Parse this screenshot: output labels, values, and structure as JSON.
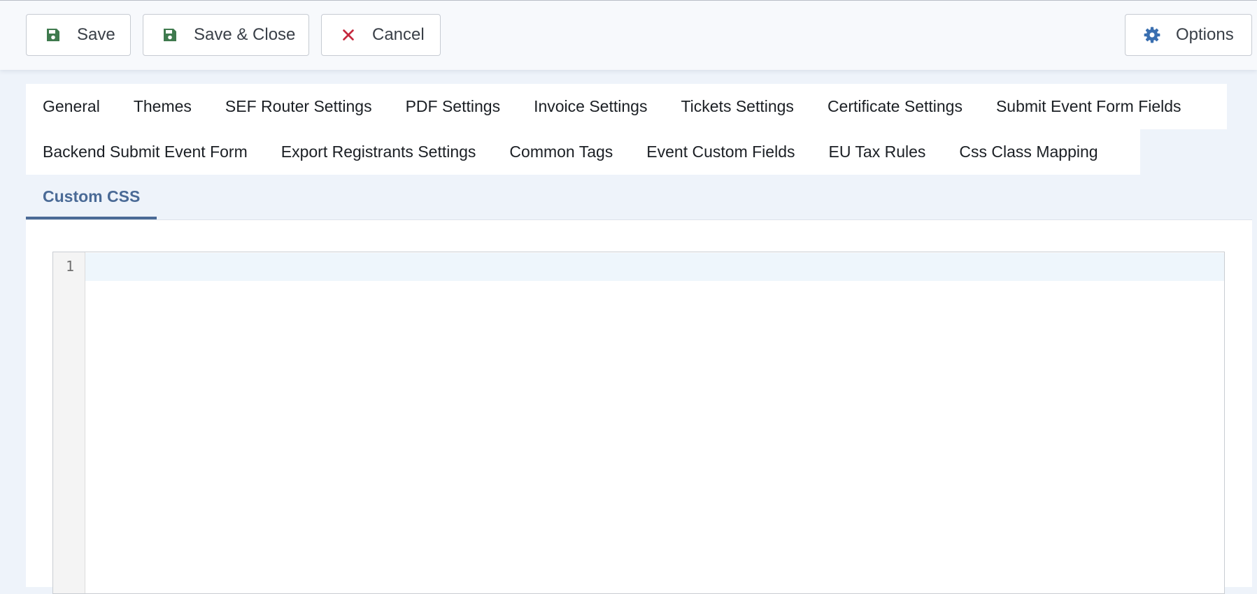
{
  "toolbar": {
    "save_label": "Save",
    "save_close_label": "Save & Close",
    "cancel_label": "Cancel",
    "options_label": "Options"
  },
  "tabs": {
    "row1": [
      "General",
      "Themes",
      "SEF Router Settings",
      "PDF Settings",
      "Invoice Settings",
      "Tickets Settings",
      "Certificate Settings",
      "Submit Event Form Fields"
    ],
    "row2": [
      "Backend Submit Event Form",
      "Export Registrants Settings",
      "Common Tags",
      "Event Custom Fields",
      "EU Tax Rules",
      "Css Class Mapping"
    ],
    "active": "Custom CSS"
  },
  "editor": {
    "line_numbers": [
      "1"
    ]
  },
  "colors": {
    "save_icon": "#3f7a4e",
    "cancel_icon": "#c5283d",
    "options_icon": "#3a6fb0",
    "active_tab": "#4a6a96"
  },
  "icons": {
    "save": "floppy-disk-icon",
    "save_close": "floppy-disk-icon",
    "cancel": "close-icon",
    "options": "gear-icon"
  }
}
